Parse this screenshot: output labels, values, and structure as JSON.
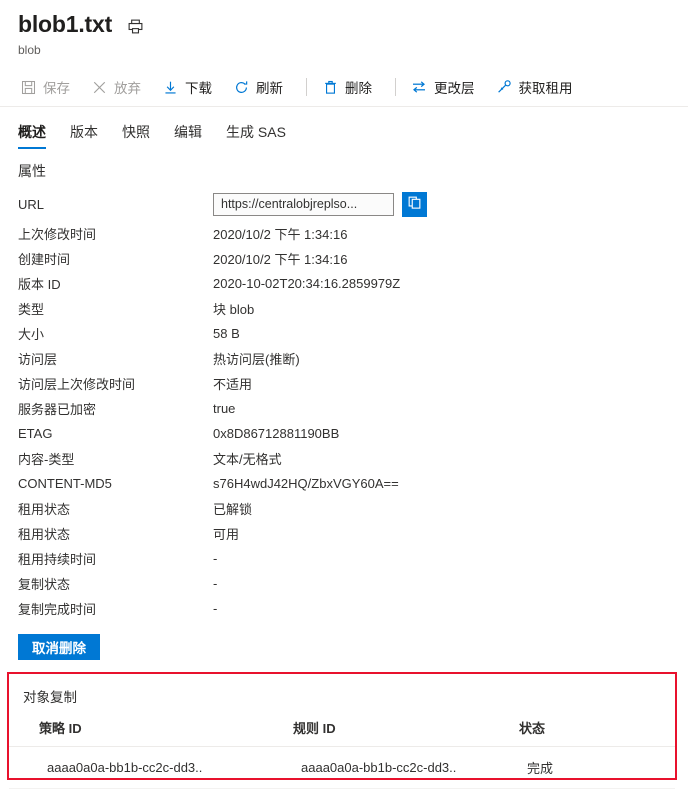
{
  "header": {
    "title": "blob1.txt",
    "subtitle": "blob",
    "print_icon": "printer-icon"
  },
  "toolbar": {
    "items": [
      {
        "label": "保存",
        "icon": "save-icon",
        "disabled": true
      },
      {
        "label": "放弃",
        "icon": "discard-x-icon",
        "disabled": true
      },
      {
        "label": "下载",
        "icon": "download-icon",
        "disabled": false
      },
      {
        "label": "刷新",
        "icon": "refresh-icon",
        "disabled": false
      },
      {
        "label": "删除",
        "icon": "delete-trash-icon",
        "disabled": false
      },
      {
        "label": "更改层",
        "icon": "change-tier-swap-icon",
        "disabled": false
      },
      {
        "label": "获取租用",
        "icon": "acquire-lease-key-icon",
        "disabled": false
      }
    ]
  },
  "tabs": [
    {
      "label": "概述",
      "active": true
    },
    {
      "label": "版本",
      "active": false
    },
    {
      "label": "快照",
      "active": false
    },
    {
      "label": "编辑",
      "active": false
    },
    {
      "label": "生成 SAS",
      "active": false
    }
  ],
  "properties": {
    "section_title": "属性",
    "url": {
      "label": "URL",
      "value": "https://centralobjreplso...",
      "copy_icon": "copy-icon"
    },
    "rows": [
      {
        "label": "上次修改时间",
        "value": "2020/10/2 下午 1:34:16"
      },
      {
        "label": "创建时间",
        "value": "2020/10/2 下午 1:34:16"
      },
      {
        "label": "版本 ID",
        "value": "2020-10-02T20:34:16.2859979Z"
      },
      {
        "label": "类型",
        "value": "块 blob"
      },
      {
        "label": "大小",
        "value": "58 B"
      },
      {
        "label": "访问层",
        "value": "热访问层(推断)"
      },
      {
        "label": "访问层上次修改时间",
        "value": "不适用"
      },
      {
        "label": "服务器已加密",
        "value": "true"
      },
      {
        "label": "ETAG",
        "value": "0x8D86712881190BB"
      },
      {
        "label": "内容-类型",
        "value": "文本/无格式"
      },
      {
        "label": "CONTENT-MD5",
        "value": "s76H4wdJ42HQ/ZbxVGY60A=="
      },
      {
        "label": "租用状态",
        "value": "已解锁"
      },
      {
        "label": "租用状态",
        "value": "可用"
      },
      {
        "label": "租用持续时间",
        "value": "-"
      },
      {
        "label": "复制状态",
        "value": "-"
      },
      {
        "label": "复制完成时间",
        "value": "-"
      }
    ]
  },
  "undelete_button": {
    "label": "取消删除"
  },
  "object_replication": {
    "title": "对象复制",
    "highlight_color": "#e8112d",
    "columns": [
      "策略 ID",
      "规则 ID",
      "状态"
    ],
    "rows": [
      [
        "aaaa0a0a-bb1b-cc2c-dd3..",
        "aaaa0a0a-bb1b-cc2c-dd3..",
        "完成"
      ]
    ]
  },
  "colors": {
    "accent": "#0078d4",
    "text": "#323130",
    "disabled": "#a19f9d",
    "highlight": "#e8112d"
  }
}
